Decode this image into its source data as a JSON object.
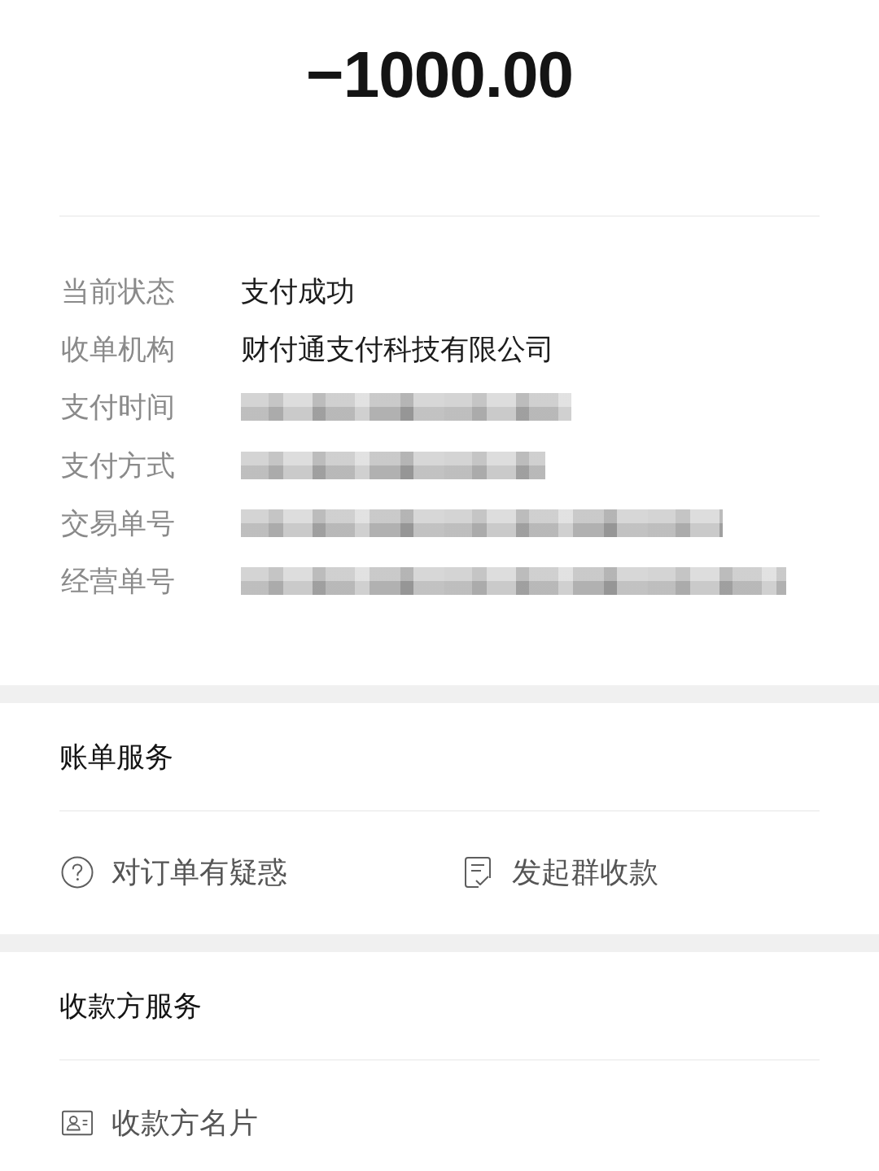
{
  "amount": "−1000.00",
  "details": [
    {
      "label": "当前状态",
      "kind": "text",
      "value": "支付成功"
    },
    {
      "label": "收单机构",
      "kind": "text",
      "value": "财付通支付科技有限公司"
    },
    {
      "label": "支付时间",
      "kind": "redacted"
    },
    {
      "label": "支付方式",
      "kind": "redacted"
    },
    {
      "label": "交易单号",
      "kind": "redacted"
    },
    {
      "label": "经营单号",
      "kind": "redacted"
    }
  ],
  "sections": [
    {
      "title": "账单服务",
      "items": [
        {
          "label": "对订单有疑惑",
          "kind": "help"
        },
        {
          "label": "发起群收款",
          "kind": "split"
        }
      ]
    },
    {
      "title": "收款方服务",
      "items": [
        {
          "label": "收款方名片",
          "kind": "profile"
        }
      ]
    }
  ]
}
